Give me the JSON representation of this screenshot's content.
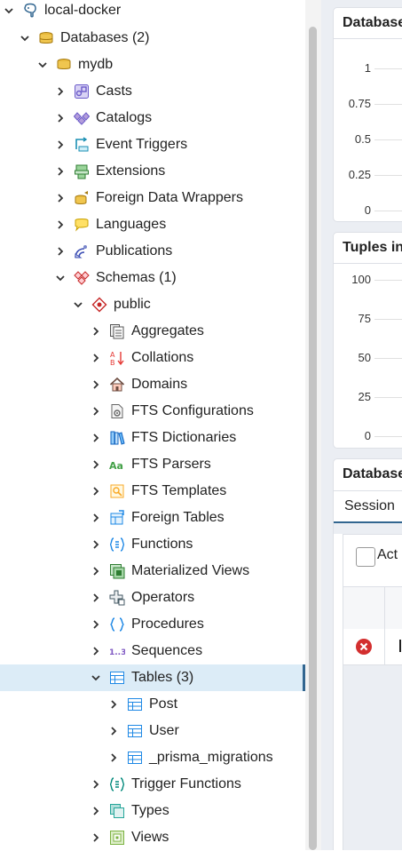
{
  "tree": {
    "items": [
      {
        "label": "local-docker",
        "icon": "postgres-server-icon"
      },
      {
        "label": "Databases (2)",
        "icon": "databases-icon"
      },
      {
        "label": "mydb",
        "icon": "database-icon"
      },
      {
        "label": "Casts",
        "icon": "casts-icon"
      },
      {
        "label": "Catalogs",
        "icon": "catalogs-icon"
      },
      {
        "label": "Event Triggers",
        "icon": "event-triggers-icon"
      },
      {
        "label": "Extensions",
        "icon": "extensions-icon"
      },
      {
        "label": "Foreign Data Wrappers",
        "icon": "foreign-data-wrappers-icon"
      },
      {
        "label": "Languages",
        "icon": "languages-icon"
      },
      {
        "label": "Publications",
        "icon": "publications-icon"
      },
      {
        "label": "Schemas (1)",
        "icon": "schemas-icon"
      },
      {
        "label": "public",
        "icon": "schema-icon"
      },
      {
        "label": "Aggregates",
        "icon": "aggregates-icon"
      },
      {
        "label": "Collations",
        "icon": "collations-icon"
      },
      {
        "label": "Domains",
        "icon": "domains-icon"
      },
      {
        "label": "FTS Configurations",
        "icon": "fts-configurations-icon"
      },
      {
        "label": "FTS Dictionaries",
        "icon": "fts-dictionaries-icon"
      },
      {
        "label": "FTS Parsers",
        "icon": "fts-parsers-icon"
      },
      {
        "label": "FTS Templates",
        "icon": "fts-templates-icon"
      },
      {
        "label": "Foreign Tables",
        "icon": "foreign-tables-icon"
      },
      {
        "label": "Functions",
        "icon": "functions-icon"
      },
      {
        "label": "Materialized Views",
        "icon": "materialized-views-icon"
      },
      {
        "label": "Operators",
        "icon": "operators-icon"
      },
      {
        "label": "Procedures",
        "icon": "procedures-icon"
      },
      {
        "label": "Sequences",
        "icon": "sequences-icon"
      },
      {
        "label": "Tables (3)",
        "icon": "tables-icon"
      },
      {
        "label": "Post",
        "icon": "table-icon"
      },
      {
        "label": "User",
        "icon": "table-icon"
      },
      {
        "label": "_prisma_migrations",
        "icon": "table-icon"
      },
      {
        "label": "Trigger Functions",
        "icon": "trigger-functions-icon"
      },
      {
        "label": "Types",
        "icon": "types-icon"
      },
      {
        "label": "Views",
        "icon": "views-icon"
      }
    ]
  },
  "dashboard": {
    "panel1": {
      "title": "Database",
      "ticks": [
        "1",
        "0.75",
        "0.5",
        "0.25",
        "0"
      ]
    },
    "panel2": {
      "title": "Tuples in",
      "ticks": [
        "100",
        "75",
        "50",
        "25",
        "0"
      ]
    },
    "panel3": {
      "title": "Database",
      "tab": "Session",
      "checkbox_label": "Act"
    }
  },
  "colors": {
    "accent": "#326690",
    "selected_bg": "#dcecf7",
    "error": "#d32f2f"
  }
}
